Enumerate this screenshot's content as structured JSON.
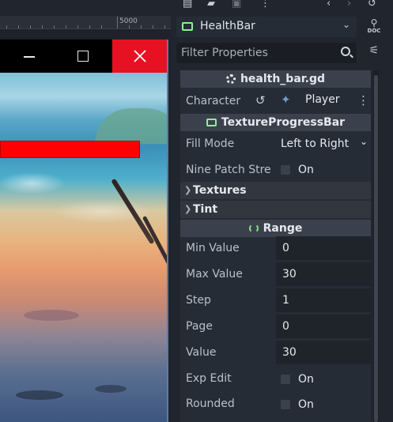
{
  "viewport": {
    "ruler_label": "5000",
    "window_buttons": {
      "minimize": "—",
      "maximize": "□",
      "close": "✕"
    }
  },
  "inspector": {
    "toolbar_icons": [
      "new-resource-icon",
      "open-resource-icon",
      "save-resource-icon",
      "more-icon",
      "history-back-icon",
      "history-forward-icon",
      "object-history-icon"
    ],
    "node_select": {
      "value": "HealthBar",
      "icon": "texture-progress-bar-icon"
    },
    "doc_label": "DOC",
    "filter": {
      "placeholder": "Filter Properties"
    },
    "script_header": "health_bar.gd",
    "character": {
      "label": "Character",
      "value": "Player"
    },
    "class_header": "TextureProgressBar",
    "fill_mode": {
      "label": "Fill Mode",
      "value": "Left to Right"
    },
    "nine_patch": {
      "label": "Nine Patch Stret",
      "toggle_label": "On",
      "checked": false
    },
    "groups": {
      "textures": "Textures",
      "tint": "Tint"
    },
    "range_header": "Range",
    "range": {
      "min_value": {
        "label": "Min Value",
        "value": "0"
      },
      "max_value": {
        "label": "Max Value",
        "value": "30"
      },
      "step": {
        "label": "Step",
        "value": "1"
      },
      "page": {
        "label": "Page",
        "value": "0"
      },
      "value": {
        "label": "Value",
        "value": "30"
      },
      "exp_edit": {
        "label": "Exp Edit",
        "toggle_label": "On",
        "checked": false
      },
      "rounded": {
        "label": "Rounded",
        "toggle_label": "On",
        "checked": false
      }
    }
  },
  "colors": {
    "editor_bg": "#21262e",
    "section_header": "#3b414c",
    "close_button": "#e81123",
    "health_bar": "#ff0000",
    "node_icon_green": "#8eef97"
  }
}
